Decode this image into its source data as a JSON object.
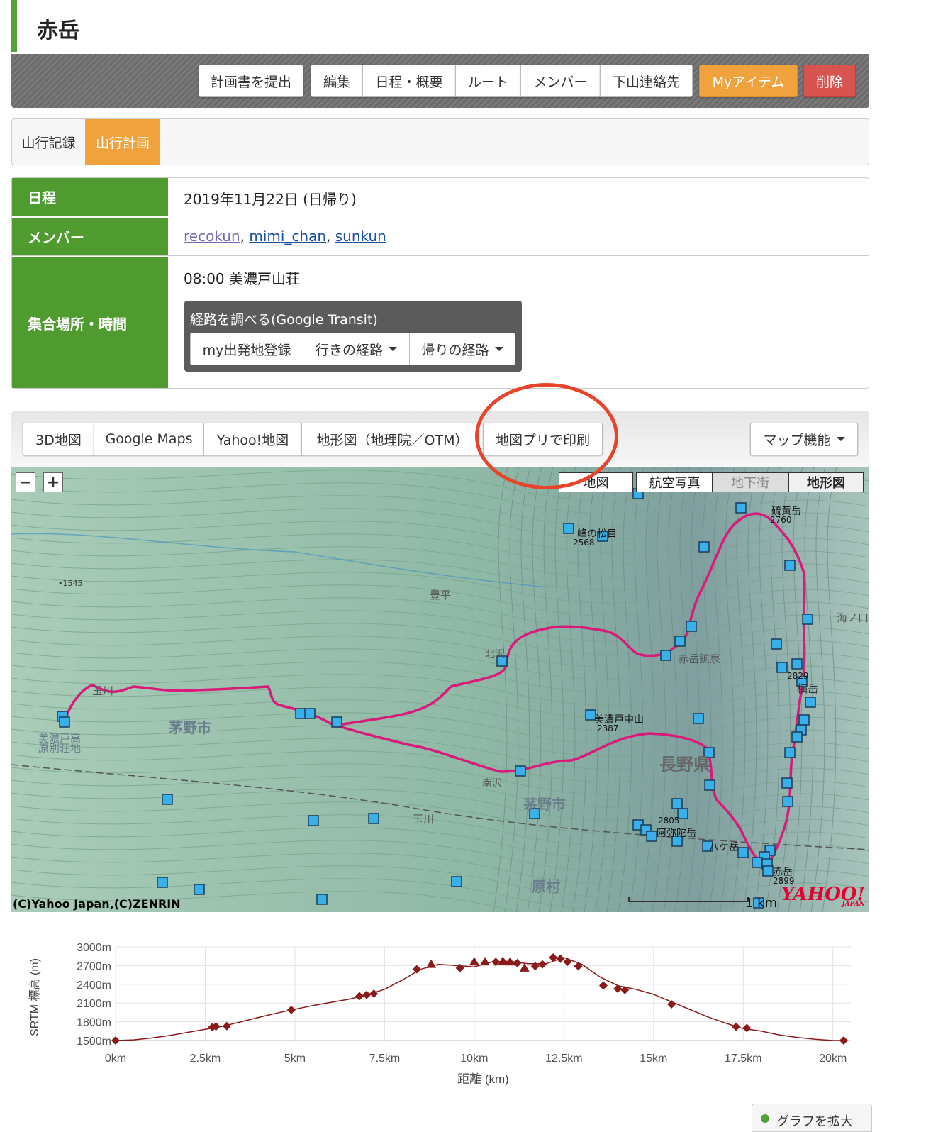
{
  "page": {
    "title": "赤岳"
  },
  "toolbar": {
    "submit_plan": "計画書を提出",
    "edit": "編集",
    "schedule": "日程・概要",
    "route": "ルート",
    "members": "メンバー",
    "contact": "下山連絡先",
    "my_item": "Myアイテム",
    "delete": "削除"
  },
  "tabs": {
    "record": "山行記録",
    "plan": "山行計画"
  },
  "info": {
    "date_label": "日程",
    "date_value": "2019年11月22日 (日帰り)",
    "member_label": "メンバー",
    "members": [
      "recokun",
      "mimi_chan",
      "sunkun"
    ],
    "separator": ", ",
    "meet_label": "集合場所・時間",
    "meet_value": "08:00 美濃戸山荘",
    "transit_title": "経路を調べる(Google Transit)",
    "transit_my_start": "my出発地登録",
    "transit_go": "行きの経路",
    "transit_back": "帰りの経路"
  },
  "map_tools": {
    "map3d": "3D地図",
    "google": "Google Maps",
    "yahoo": "Yahoo!地図",
    "topo": "地形図（地理院／OTM）",
    "print": "地図プリで印刷",
    "features": "マップ機能"
  },
  "map": {
    "zoom_out": "−",
    "zoom_in": "+",
    "types": [
      "地図",
      "航空写真",
      "地下街",
      "地形図"
    ],
    "copyright": "(C)Yahoo Japan,(C)ZENRIN",
    "scale_label": "1 km",
    "logo": "YAHOO!",
    "logo_sub": "JAPAN",
    "route_color": "#d81b7a",
    "place_labels": [
      "硫黄岳",
      "2760",
      "峰の松目",
      "2568",
      "豊平",
      "赤岳鉱泉",
      "2829",
      "横岳",
      "美濃戸中山",
      "2387",
      "長野県",
      "茅野市",
      "茅野市",
      "玉川",
      "玉川",
      "南沢",
      "美濃戸高",
      "原別荘地",
      "阿弥陀岳",
      "2805",
      "八ケ岳",
      "赤岳",
      "2899",
      "原村",
      "•1545",
      "北沢",
      "海ノ口"
    ]
  },
  "chart_data": {
    "type": "line",
    "xlabel": "距離 (km)",
    "ylabel": "SRTM 標高 (m)",
    "x_ticks": [
      "0km",
      "2.5km",
      "5km",
      "7.5km",
      "10km",
      "12.5km",
      "15km",
      "17.5km",
      "20km"
    ],
    "y_ticks": [
      "1500m",
      "1800m",
      "2100m",
      "2400m",
      "2700m",
      "3000m"
    ],
    "xlim": [
      0,
      20.5
    ],
    "ylim": [
      1500,
      3000
    ],
    "grid": true,
    "color": "#8b1a1a",
    "series": [
      {
        "x": [
          0,
          0.5,
          1,
          1.5,
          2,
          2.5,
          3,
          3.5,
          4,
          4.5,
          5,
          5.5,
          6,
          6.5,
          7,
          7.5,
          8,
          8.5,
          9,
          9.5,
          10,
          10.5,
          11,
          11.5,
          12,
          12.5,
          13,
          13.5,
          14,
          14.5,
          15,
          15.5,
          16,
          16.5,
          17,
          17.5,
          18,
          18.5,
          19,
          19.5,
          20,
          20.3
        ],
        "y": [
          1500,
          1510,
          1540,
          1580,
          1630,
          1680,
          1730,
          1800,
          1870,
          1940,
          2000,
          2060,
          2110,
          2160,
          2230,
          2320,
          2470,
          2640,
          2720,
          2700,
          2680,
          2760,
          2770,
          2730,
          2730,
          2830,
          2720,
          2520,
          2380,
          2320,
          2240,
          2120,
          2000,
          1880,
          1780,
          1690,
          1650,
          1590,
          1550,
          1520,
          1500,
          1500
        ]
      }
    ],
    "markers": [
      {
        "x": 0,
        "y": 1500,
        "shape": "diamond"
      },
      {
        "x": 2.7,
        "y": 1715,
        "shape": "diamond"
      },
      {
        "x": 2.8,
        "y": 1725,
        "shape": "diamond"
      },
      {
        "x": 3.1,
        "y": 1730,
        "shape": "diamond"
      },
      {
        "x": 4.9,
        "y": 1990,
        "shape": "diamond"
      },
      {
        "x": 6.8,
        "y": 2210,
        "shape": "diamond"
      },
      {
        "x": 7.0,
        "y": 2230,
        "shape": "diamond"
      },
      {
        "x": 7.2,
        "y": 2250,
        "shape": "diamond"
      },
      {
        "x": 8.4,
        "y": 2640,
        "shape": "diamond"
      },
      {
        "x": 8.8,
        "y": 2720,
        "shape": "triangle"
      },
      {
        "x": 9.6,
        "y": 2660,
        "shape": "diamond"
      },
      {
        "x": 10.0,
        "y": 2760,
        "shape": "triangle"
      },
      {
        "x": 10.3,
        "y": 2760,
        "shape": "triangle"
      },
      {
        "x": 10.6,
        "y": 2760,
        "shape": "diamond"
      },
      {
        "x": 10.8,
        "y": 2770,
        "shape": "triangle"
      },
      {
        "x": 11.0,
        "y": 2760,
        "shape": "triangle"
      },
      {
        "x": 11.2,
        "y": 2740,
        "shape": "diamond"
      },
      {
        "x": 11.4,
        "y": 2660,
        "shape": "triangle"
      },
      {
        "x": 11.7,
        "y": 2690,
        "shape": "diamond"
      },
      {
        "x": 11.9,
        "y": 2720,
        "shape": "diamond"
      },
      {
        "x": 12.2,
        "y": 2830,
        "shape": "diamond"
      },
      {
        "x": 12.4,
        "y": 2810,
        "shape": "diamond"
      },
      {
        "x": 12.6,
        "y": 2760,
        "shape": "diamond"
      },
      {
        "x": 12.9,
        "y": 2690,
        "shape": "diamond"
      },
      {
        "x": 13.6,
        "y": 2380,
        "shape": "diamond"
      },
      {
        "x": 14.0,
        "y": 2330,
        "shape": "diamond"
      },
      {
        "x": 14.2,
        "y": 2310,
        "shape": "diamond"
      },
      {
        "x": 15.5,
        "y": 2080,
        "shape": "diamond"
      },
      {
        "x": 17.3,
        "y": 1720,
        "shape": "diamond"
      },
      {
        "x": 17.6,
        "y": 1700,
        "shape": "diamond"
      },
      {
        "x": 20.3,
        "y": 1500,
        "shape": "diamond"
      }
    ]
  },
  "legend": {
    "label": "グラフを拡大"
  }
}
